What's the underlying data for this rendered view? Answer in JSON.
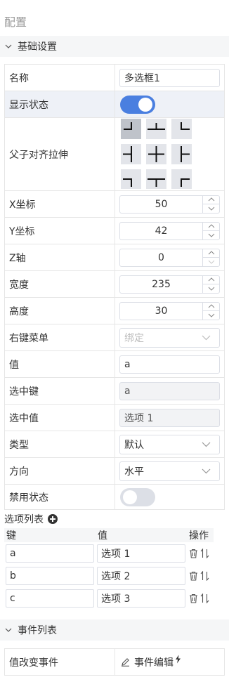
{
  "panel": {
    "title": "配置"
  },
  "basic_section": {
    "title": "基础设置",
    "expanded": true
  },
  "props": {
    "name": {
      "label": "名称",
      "value": "多选框1"
    },
    "visible": {
      "label": "显示状态",
      "on": true
    },
    "align": {
      "label": "父子对齐拉伸",
      "active_index": 0
    },
    "x": {
      "label": "X坐标",
      "value": "50"
    },
    "y": {
      "label": "Y坐标",
      "value": "42"
    },
    "z": {
      "label": "Z轴",
      "value": "0"
    },
    "width": {
      "label": "宽度",
      "value": "235"
    },
    "height": {
      "label": "高度",
      "value": "30"
    },
    "context_menu": {
      "label": "右键菜单",
      "placeholder": "绑定"
    },
    "value": {
      "label": "值",
      "value": "a"
    },
    "selected_key": {
      "label": "选中键",
      "value": "a"
    },
    "selected_value": {
      "label": "选中值",
      "value": "选项 1"
    },
    "type": {
      "label": "类型",
      "value": "默认"
    },
    "direction": {
      "label": "方向",
      "value": "水平"
    },
    "disabled": {
      "label": "禁用状态",
      "on": false
    }
  },
  "options_list": {
    "title": "选项列表",
    "headers": {
      "key": "键",
      "value": "值",
      "actions": "操作"
    },
    "rows": [
      {
        "key": "a",
        "value": "选项 1"
      },
      {
        "key": "b",
        "value": "选项 2"
      },
      {
        "key": "c",
        "value": "选项 3"
      }
    ]
  },
  "events_section": {
    "title": "事件列表",
    "expanded": true
  },
  "events": [
    {
      "label": "值改变事件",
      "action": "事件编辑"
    }
  ],
  "colors": {
    "accent": "#4a7fe0",
    "section_bg": "#f5f6f7",
    "highlight_row": "#eef1f7",
    "border": "#e6e6e6"
  }
}
